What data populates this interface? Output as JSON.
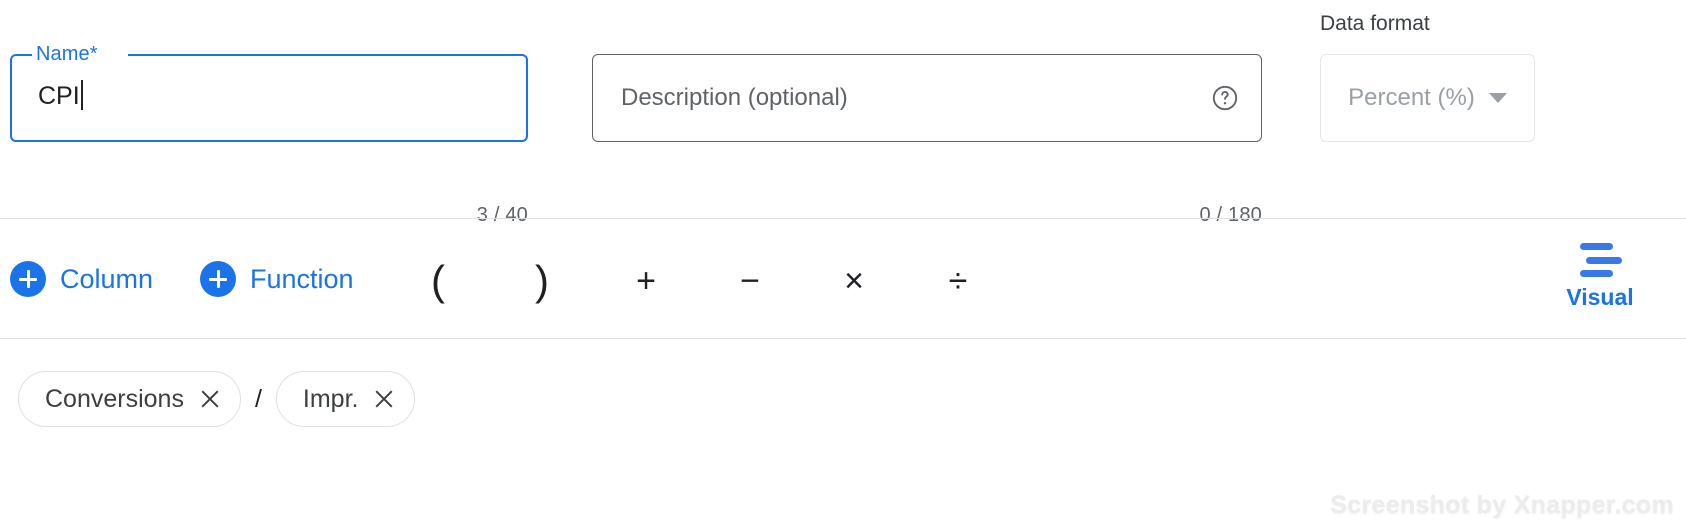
{
  "name_field": {
    "label": "Name*",
    "value": "CPI",
    "counter": "3 / 40"
  },
  "description_field": {
    "placeholder": "Description (optional)",
    "value": "",
    "counter": "0 / 180",
    "help_icon": "help-circle-icon"
  },
  "data_format": {
    "label": "Data format",
    "value": "Percent (%)",
    "chevron_icon": "chevron-down-icon"
  },
  "toolbar": {
    "column_label": "Column",
    "function_label": "Function",
    "column_icon": "plus-circle-icon",
    "function_icon": "plus-circle-icon",
    "operators": [
      {
        "name": "paren-open",
        "glyph": "("
      },
      {
        "name": "paren-close",
        "glyph": ")"
      },
      {
        "name": "plus",
        "glyph": "+"
      },
      {
        "name": "minus",
        "glyph": "−"
      },
      {
        "name": "multiply",
        "glyph": "×"
      },
      {
        "name": "divide",
        "glyph": "÷"
      }
    ],
    "visual_label": "Visual",
    "visual_icon": "align-bars-icon"
  },
  "formula": {
    "chips": [
      {
        "label": "Conversions",
        "close_icon": "close-icon"
      },
      {
        "label": "Impr.",
        "close_icon": "close-icon"
      }
    ],
    "operator": "/"
  },
  "watermark": "Screenshot by Xnapper.com",
  "colors": {
    "accent_blue": "#1a73e8",
    "text_primary": "#202124",
    "text_secondary": "#5f6368",
    "text_disabled": "#9aa0a6",
    "border_light": "#e0e0e0"
  }
}
